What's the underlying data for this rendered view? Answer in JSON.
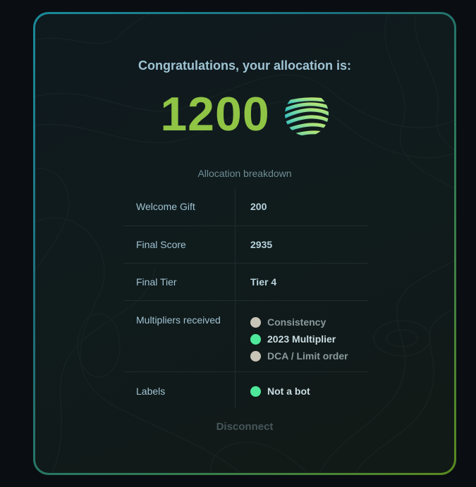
{
  "header": {
    "title": "Congratulations, your allocation is:",
    "amount": "1200",
    "logo_icon": "striped-globe-icon"
  },
  "breakdown": {
    "heading": "Allocation breakdown",
    "rows": [
      {
        "label": "Welcome Gift",
        "value": "200"
      },
      {
        "label": "Final Score",
        "value": "2935"
      },
      {
        "label": "Final Tier",
        "value": "Tier 4"
      }
    ],
    "multipliers": {
      "label": "Multipliers received",
      "items": [
        {
          "label": "Consistency",
          "active": false
        },
        {
          "label": "2023 Multiplier",
          "active": true
        },
        {
          "label": "DCA / Limit order",
          "active": false
        }
      ]
    },
    "labels": {
      "label": "Labels",
      "items": [
        {
          "label": "Not a bot",
          "active": true
        }
      ]
    }
  },
  "actions": {
    "disconnect_label": "Disconnect"
  },
  "colors": {
    "accent_green": "#8fc445",
    "active_dot": "#4ee89b",
    "inactive_dot": "#c8c4b8",
    "title_text": "#9fc3d3"
  }
}
